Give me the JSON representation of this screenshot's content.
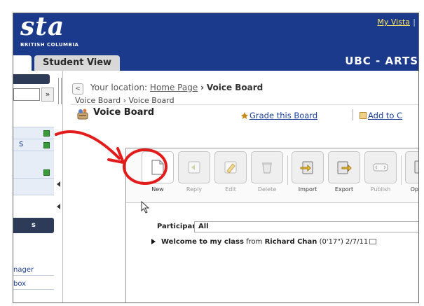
{
  "header": {
    "logo_text": "sta",
    "subtitle": "BRITISH COLUMBIA",
    "my_vista_link": "My Vista",
    "separator": "|",
    "course_title": "UBC - ARTS",
    "tabs": [
      {
        "label": "Student View"
      }
    ]
  },
  "sidebar": {
    "dropdown_chevron": "»",
    "band_item_letter": "s",
    "dark_header_letter": "s",
    "links": [
      {
        "label": "nager"
      },
      {
        "label": "box"
      }
    ]
  },
  "location": {
    "back_glyph": "<",
    "prefix": "Your location:",
    "home_link": "Home Page",
    "arrow": "›",
    "current": "Voice Board"
  },
  "breadcrumb": {
    "items": [
      "Voice Board",
      "›",
      "Voice Board"
    ]
  },
  "page": {
    "title": "Voice Board",
    "grade_link": "Grade this Board",
    "add_link": "Add to C"
  },
  "toolbar": {
    "buttons": [
      {
        "label": "New",
        "enabled": true
      },
      {
        "label": "Reply",
        "enabled": false
      },
      {
        "label": "Edit",
        "enabled": false
      },
      {
        "label": "Delete",
        "enabled": false
      },
      {
        "label": "Import",
        "enabled": true
      },
      {
        "label": "Export",
        "enabled": true
      },
      {
        "label": "Publish",
        "enabled": false
      },
      {
        "label": "Options",
        "enabled": true
      }
    ]
  },
  "participants": {
    "label": "Participants:",
    "value": "All"
  },
  "threads": [
    {
      "title": "Welcome to my class",
      "from_word": "from",
      "author": "Richard Chan",
      "duration": "(0'17\")",
      "date": "2/7/11"
    }
  ],
  "colors": {
    "header_blue": "#1b3a8c",
    "link_yellow": "#ffe46a",
    "annotation_red": "#e21b1b"
  }
}
